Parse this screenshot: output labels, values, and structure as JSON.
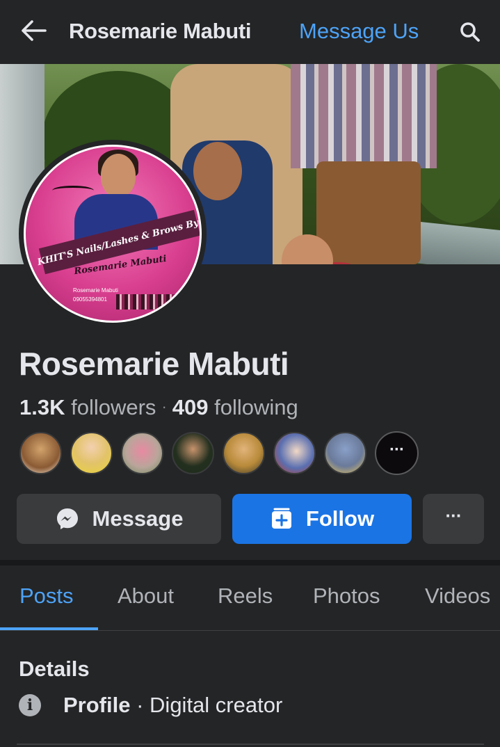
{
  "topbar": {
    "title": "Rosemarie Mabuti",
    "message_us": "Message Us",
    "back_icon": "arrow-left-icon",
    "search_icon": "search-icon"
  },
  "profile": {
    "name": "Rosemarie Mabuti",
    "followers_count": "1.3K",
    "followers_label": "followers",
    "separator": "·",
    "following_count": "409",
    "following_label": "following",
    "avatar_text": {
      "banner": "KHIT'S Nails/Lashes & Brows By:",
      "signature": "Rosemarie Mabuti",
      "contact_name": "Rosemarie Mabuti",
      "contact_phone": "09055394801"
    }
  },
  "friends": {
    "more_label": "···",
    "colors": [
      "#b88a5c",
      "#e7c46a",
      "#c97e8a",
      "#2e3b2a",
      "#c8a45a",
      "#6b7fb0",
      "#7a8cb0"
    ]
  },
  "actions": {
    "message_label": "Message",
    "follow_label": "Follow",
    "more_label": "···"
  },
  "tabs": [
    {
      "label": "Posts",
      "active": true
    },
    {
      "label": "About",
      "active": false
    },
    {
      "label": "Reels",
      "active": false
    },
    {
      "label": "Photos",
      "active": false
    },
    {
      "label": "Videos",
      "active": false
    }
  ],
  "details": {
    "title": "Details",
    "row_label": "Profile",
    "row_separator": "·",
    "row_value": "Digital creator"
  },
  "colors": {
    "background": "#242526",
    "accent": "#4da3f8",
    "follow_button": "#1b74e4",
    "secondary_button": "#3a3b3c"
  }
}
